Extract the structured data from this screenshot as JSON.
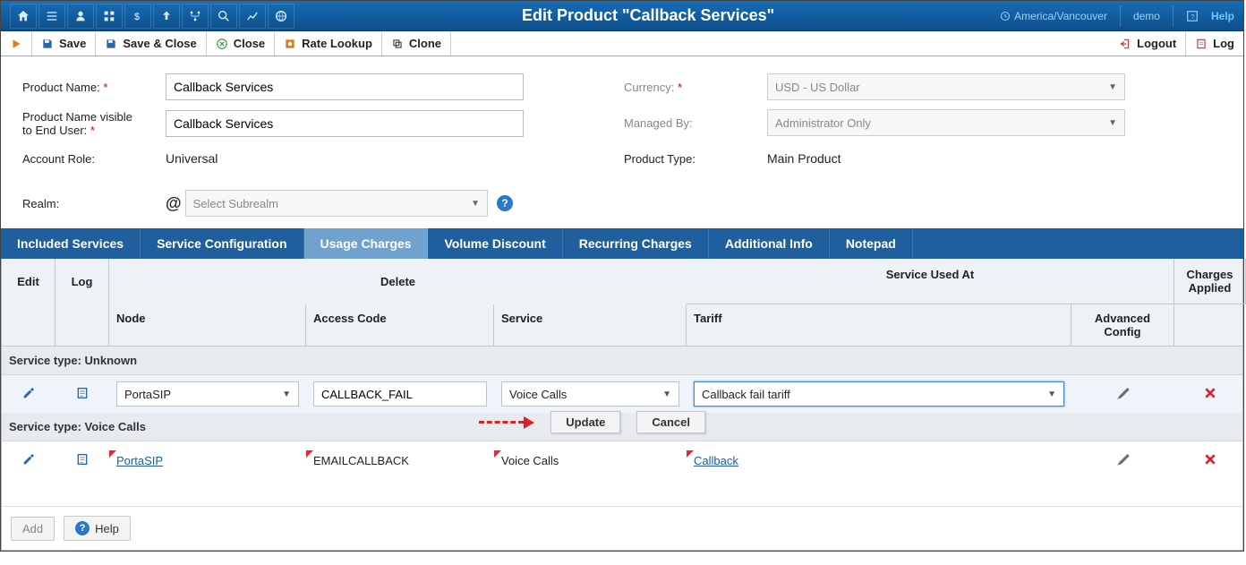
{
  "title": "Edit Product \"Callback Services\"",
  "header_right": {
    "timezone": "America/Vancouver",
    "user": "demo",
    "help": "Help"
  },
  "toolbar": {
    "save": "Save",
    "save_close": "Save & Close",
    "close": "Close",
    "rate_lookup": "Rate Lookup",
    "clone": "Clone",
    "logout": "Logout",
    "log": "Log"
  },
  "form": {
    "product_name_label": "Product Name:",
    "product_name_value": "Callback Services",
    "product_name_visible_label_1": "Product Name visible",
    "product_name_visible_label_2": "to End User:",
    "product_name_visible_value": "Callback Services",
    "account_role_label": "Account Role:",
    "account_role_value": "Universal",
    "realm_label": "Realm:",
    "realm_placeholder": "Select Subrealm",
    "currency_label": "Currency:",
    "currency_value": "USD - US Dollar",
    "managed_by_label": "Managed By:",
    "managed_by_value": "Administrator Only",
    "product_type_label": "Product Type:",
    "product_type_value": "Main Product"
  },
  "tabs": [
    "Included Services",
    "Service Configuration",
    "Usage Charges",
    "Volume Discount",
    "Recurring Charges",
    "Additional Info",
    "Notepad"
  ],
  "active_tab": 2,
  "grid": {
    "head": {
      "edit": "Edit",
      "log": "Log",
      "service_used_at": "Service Used At",
      "charges_applied": "Charges Applied",
      "delete": "Delete",
      "node": "Node",
      "access_code": "Access Code",
      "service": "Service",
      "tariff": "Tariff",
      "advanced_config": "Advanced Config"
    },
    "section1": "Service type: Unknown",
    "row1": {
      "node": "PortaSIP",
      "access_code": "CALLBACK_FAIL",
      "service": "Voice Calls",
      "tariff": "Callback fail  tariff"
    },
    "section2": "Service type: Voice Calls",
    "row2": {
      "node": "PortaSIP",
      "access_code": "EMAILCALLBACK",
      "service": "Voice Calls",
      "tariff": "Callback"
    },
    "buttons": {
      "update": "Update",
      "cancel": "Cancel"
    }
  },
  "footer": {
    "add": "Add",
    "help": "Help"
  }
}
